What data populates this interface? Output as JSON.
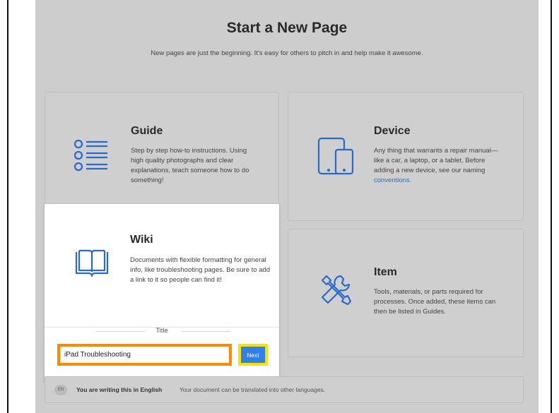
{
  "page": {
    "title": "Start a New Page",
    "subtitle": "New pages are just the beginning. It's easy for others to pitch in and help make it awesome."
  },
  "cards": {
    "guide": {
      "title": "Guide",
      "description": "Step by step how-to instructions. Using high quality photographs and clear explanations, teach someone how to do something!",
      "icon": "list-icon"
    },
    "device": {
      "title": "Device",
      "description_prefix": "Any thing that warrants a repair manual—like a car, a laptop, or a tablet. Before adding a new device, see our naming ",
      "link_text": "conventions",
      "description_suffix": ".",
      "icon": "devices-icon"
    },
    "wiki": {
      "title": "Wiki",
      "description": "Documents with flexible formatting for general info, like troubleshooting pages. Be sure to add a link to it so people can find it!",
      "icon": "book-icon",
      "field_label": "Title",
      "input_value": "iPad Troubleshooting",
      "next_label": "Next"
    },
    "item": {
      "title": "Item",
      "description": "Tools, materials, or parts required for processes. Once added, these items can then be listed in Guides.",
      "icon": "tools-icon"
    }
  },
  "language": {
    "badge": "EN",
    "strong": "You are writing this in English",
    "desc": "Your document can be translated into other languages."
  },
  "colors": {
    "accent": "#2f80e8",
    "highlight_input": "#ff8a00",
    "highlight_button": "#f5e300",
    "icon_blue": "#2a6ac9"
  }
}
